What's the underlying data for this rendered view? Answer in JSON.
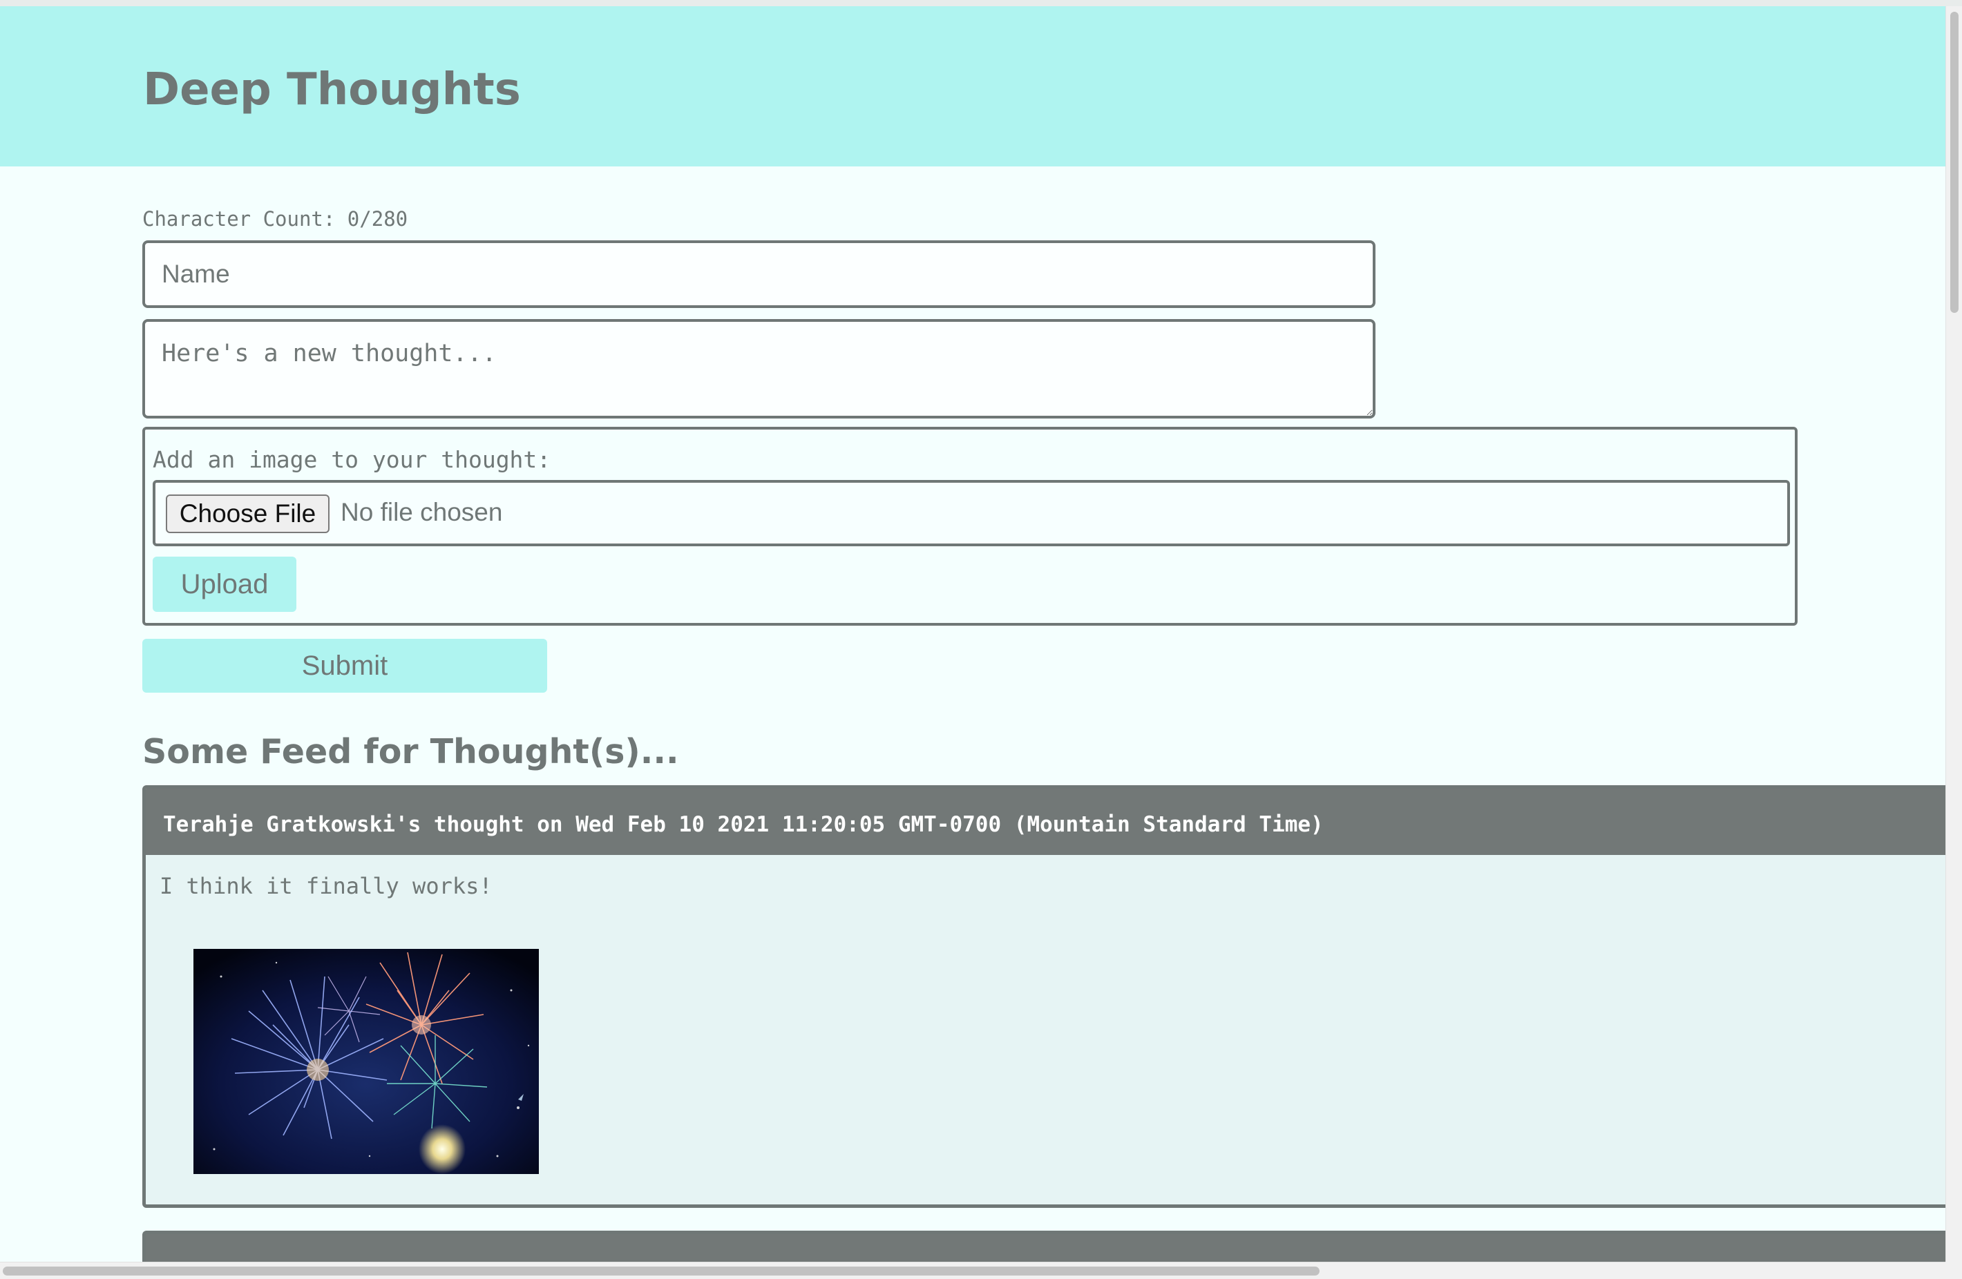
{
  "header": {
    "title": "Deep Thoughts"
  },
  "form": {
    "character_count": "Character Count: 0/280",
    "name_placeholder": "Name",
    "thought_placeholder": "Here's a new thought...",
    "image_label": "Add an image to your thought:",
    "choose_file_label": "Choose File",
    "no_file_text": "No file chosen",
    "upload_label": "Upload",
    "submit_label": "Submit"
  },
  "feed": {
    "heading": "Some Feed for Thought(s)...",
    "thoughts": [
      {
        "header": "Terahje Gratkowski's thought on Wed Feb 10 2021 11:20:05 GMT-0700 (Mountain Standard Time)",
        "text": "I think it finally works!",
        "image": "fireworks-image"
      }
    ]
  },
  "colors": {
    "accent": "#aff4f0",
    "text": "#6f7776",
    "page_bg": "#f4fffe",
    "card_header": "#727877",
    "card_bg": "#e6f4f4"
  }
}
